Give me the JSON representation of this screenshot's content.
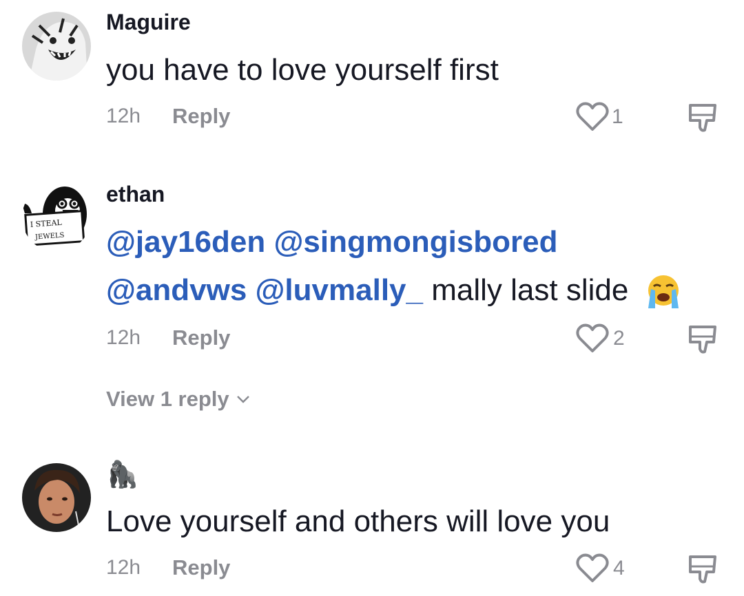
{
  "comments": [
    {
      "username": "Maguire",
      "text": "you have to love yourself first",
      "time": "12h",
      "reply_label": "Reply",
      "likes": "1"
    },
    {
      "username": "ethan",
      "mentions_line1": [
        "@jay16den",
        "@singmongisbored"
      ],
      "mentions_line2": [
        "@andvws",
        "@luvmally_"
      ],
      "text": "mally last slide",
      "emoji": "loudly-crying-face",
      "avatar_sign_line1": "I STEAL",
      "avatar_sign_line2": "JEWELS",
      "time": "12h",
      "reply_label": "Reply",
      "likes": "2",
      "view_replies": "View 1 reply"
    },
    {
      "username": "🦍",
      "text": "Love yourself and others will love you",
      "time": "12h",
      "reply_label": "Reply",
      "likes": "4"
    }
  ],
  "colors": {
    "text": "#161823",
    "secondary": "#8a8b91",
    "mention": "#2b5db9"
  }
}
